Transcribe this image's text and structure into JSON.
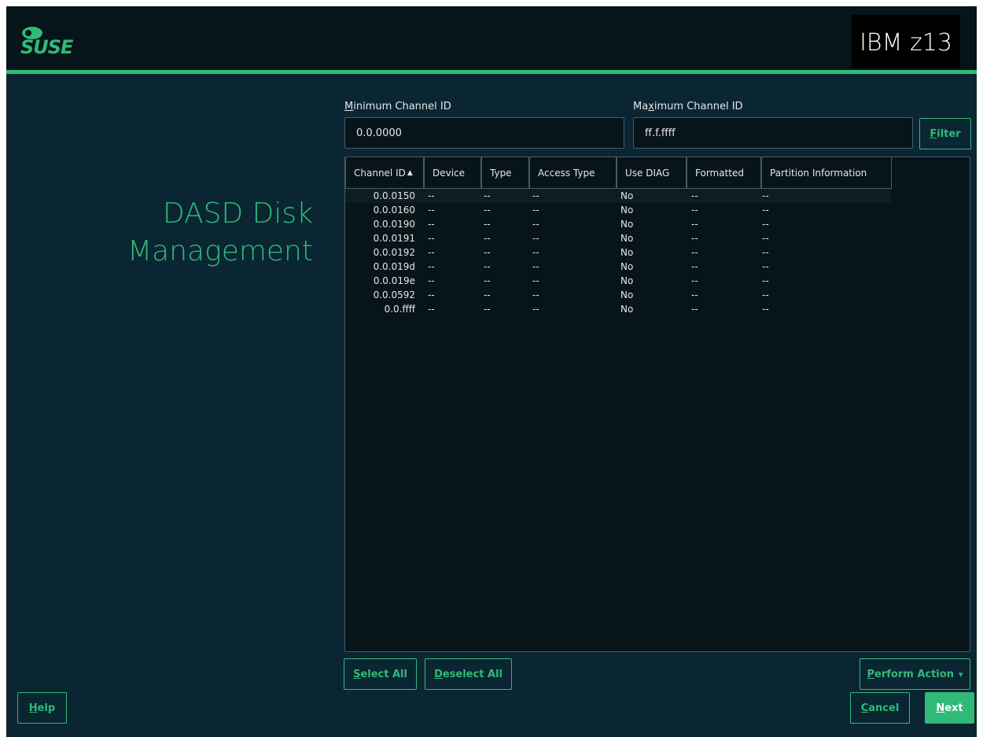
{
  "header": {
    "logo_text": "SUSE",
    "machine_label": "IBM z13"
  },
  "page": {
    "title_line1": "DASD Disk",
    "title_line2": "Management"
  },
  "filter": {
    "min_label_first": "M",
    "min_label_rest": "inimum Channel ID",
    "min_value": "0.0.0000",
    "max_label_pre": "Ma",
    "max_label_ul": "x",
    "max_label_post": "imum Channel ID",
    "max_value": "ff.f.ffff",
    "filter_button_ul": "F",
    "filter_button_rest": "ilter"
  },
  "table": {
    "columns": [
      "Channel ID",
      "Device",
      "Type",
      "Access Type",
      "Use DIAG",
      "Formatted",
      "Partition Information"
    ],
    "sort_indicator": "▲",
    "rows": [
      [
        "0.0.0150",
        "--",
        "--",
        "--",
        "No",
        "--",
        "--"
      ],
      [
        "0.0.0160",
        "--",
        "--",
        "--",
        "No",
        "--",
        "--"
      ],
      [
        "0.0.0190",
        "--",
        "--",
        "--",
        "No",
        "--",
        "--"
      ],
      [
        "0.0.0191",
        "--",
        "--",
        "--",
        "No",
        "--",
        "--"
      ],
      [
        "0.0.0192",
        "--",
        "--",
        "--",
        "No",
        "--",
        "--"
      ],
      [
        "0.0.019d",
        "--",
        "--",
        "--",
        "No",
        "--",
        "--"
      ],
      [
        "0.0.019e",
        "--",
        "--",
        "--",
        "No",
        "--",
        "--"
      ],
      [
        "0.0.0592",
        "--",
        "--",
        "--",
        "No",
        "--",
        "--"
      ],
      [
        "0.0.ffff",
        "--",
        "--",
        "--",
        "No",
        "--",
        "--"
      ]
    ]
  },
  "actions": {
    "select_all_ul": "S",
    "select_all_rest": "elect All",
    "deselect_all_ul": "D",
    "deselect_all_rest": "eselect All",
    "perform_action_ul": "P",
    "perform_action_rest": "erform Action",
    "perform_action_caret": "▾"
  },
  "footer": {
    "help_ul": "H",
    "help_rest": "elp",
    "cancel_ul": "C",
    "cancel_rest": "ancel",
    "next_ul": "N",
    "next_rest": "ext"
  },
  "colors": {
    "accent": "#30ba78",
    "background": "#0b2633",
    "header": "#07141a",
    "field": "#07141a",
    "border": "#485c66"
  }
}
